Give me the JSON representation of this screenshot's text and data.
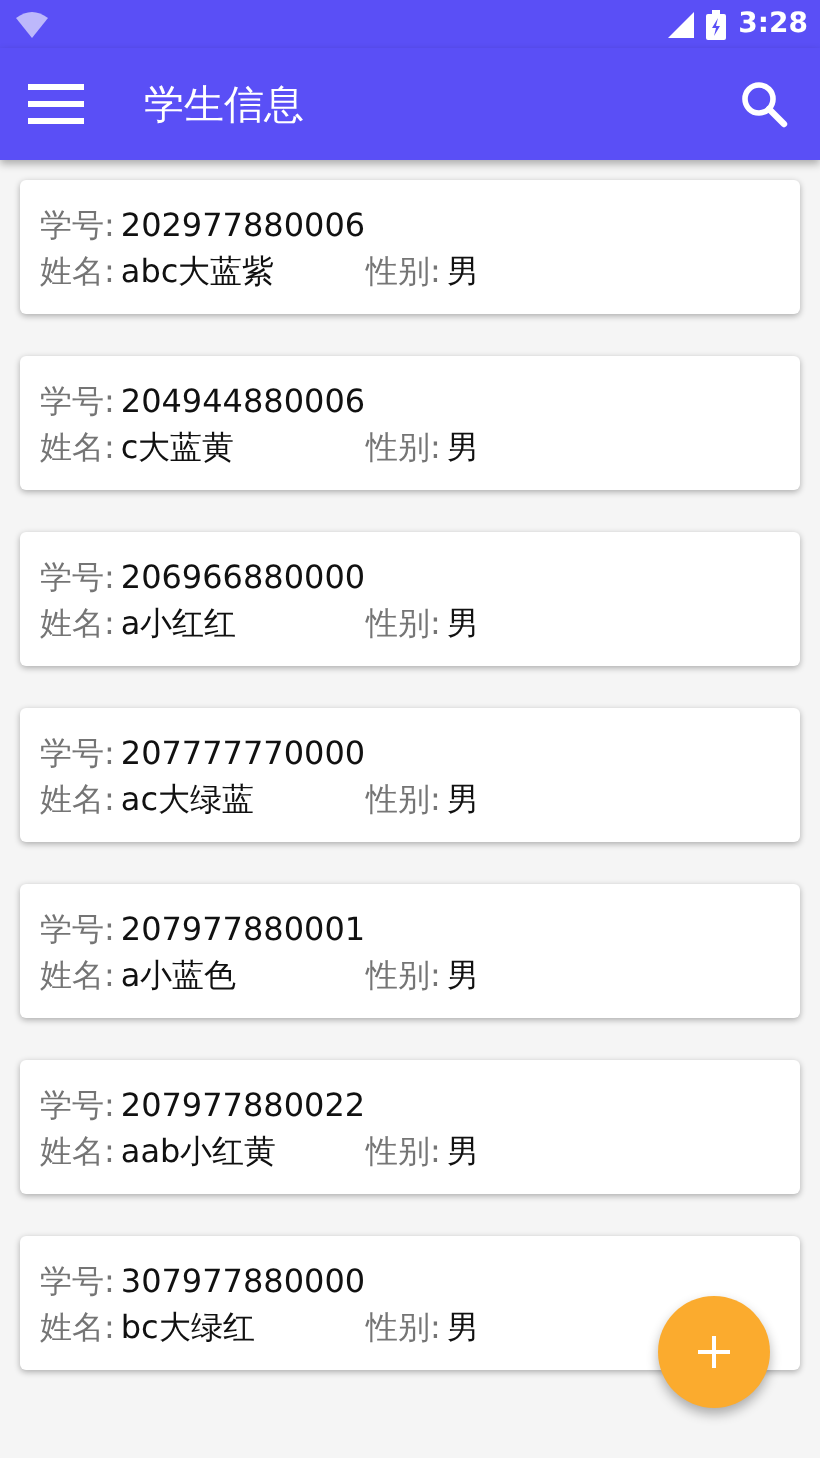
{
  "status_bar": {
    "time": "3:28"
  },
  "app_bar": {
    "title": "学生信息"
  },
  "students": [
    {
      "id_label": "学号:",
      "id": "202977880006",
      "name_label": "姓名:",
      "name": "abc大蓝紫",
      "gender_label": "性别:",
      "gender": "男"
    },
    {
      "id_label": "学号:",
      "id": "204944880006",
      "name_label": "姓名:",
      "name": "c大蓝黄",
      "gender_label": "性别:",
      "gender": "男"
    },
    {
      "id_label": "学号:",
      "id": "206966880000",
      "name_label": "姓名:",
      "name": "a小红红",
      "gender_label": "性别:",
      "gender": "男"
    },
    {
      "id_label": "学号:",
      "id": "207777770000",
      "name_label": "姓名:",
      "name": "ac大绿蓝",
      "gender_label": "性别:",
      "gender": "男"
    },
    {
      "id_label": "学号:",
      "id": "207977880001",
      "name_label": "姓名:",
      "name": "a小蓝色",
      "gender_label": "性别:",
      "gender": "男"
    },
    {
      "id_label": "学号:",
      "id": "207977880022",
      "name_label": "姓名:",
      "name": "aab小红黄",
      "gender_label": "性别:",
      "gender": "男"
    },
    {
      "id_label": "学号:",
      "id": "307977880000",
      "name_label": "姓名:",
      "name": "bc大绿红",
      "gender_label": "性别:",
      "gender": "男"
    }
  ]
}
